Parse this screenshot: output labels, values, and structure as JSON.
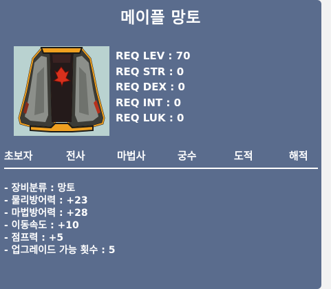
{
  "item": {
    "name": "메이플 망토",
    "icon": "cape-icon"
  },
  "requirements": [
    "REQ LEV : 70",
    "REQ STR : 0",
    "REQ DEX : 0",
    "REQ INT : 0",
    "REQ LUK : 0"
  ],
  "jobs": [
    "초보자",
    "전사",
    "마법사",
    "궁수",
    "도적",
    "해적"
  ],
  "stats": [
    "- 장비분류 : 망토",
    "- 물리방어력 : +23",
    "- 마법방어력 : +28",
    "- 이동속도 : +10",
    "- 점프력 : +5",
    "- 업그레이드 가능 횟수 : 5"
  ],
  "colors": {
    "panel": "#5a6c8d",
    "icon_bg": "#b9d2d0",
    "text": "#ffffff"
  }
}
